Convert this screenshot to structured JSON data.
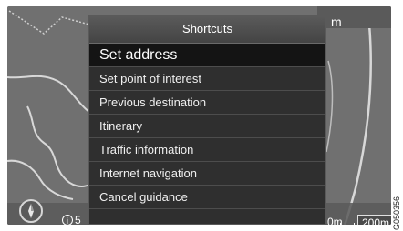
{
  "map": {
    "distance_top": "m",
    "info_value": "5",
    "distance_bottom": "0m",
    "scale_label": "200m"
  },
  "shortcuts": {
    "title": "Shortcuts",
    "items": [
      {
        "label": "Set address"
      },
      {
        "label": "Set point of interest"
      },
      {
        "label": "Previous destination"
      },
      {
        "label": "Itinerary"
      },
      {
        "label": "Traffic information"
      },
      {
        "label": "Internet navigation"
      },
      {
        "label": "Cancel guidance"
      }
    ],
    "selected_index": 0
  },
  "image_code": "G050356"
}
